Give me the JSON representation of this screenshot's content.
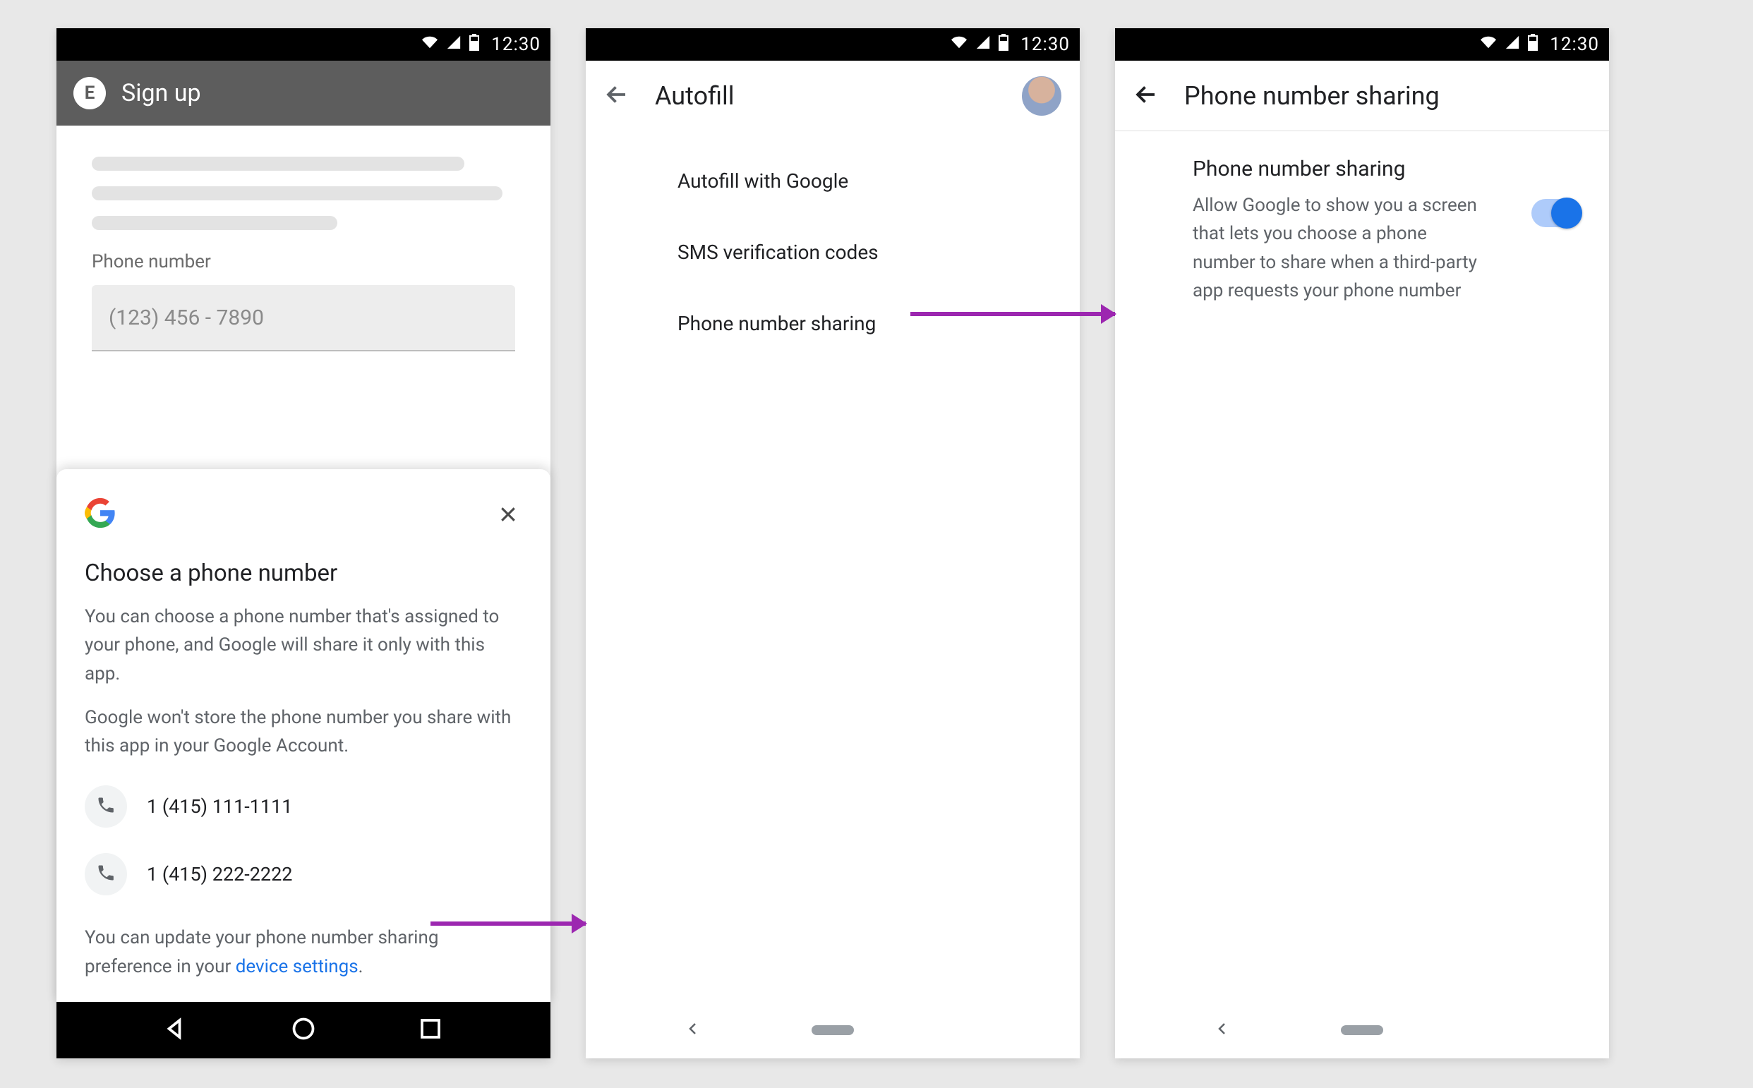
{
  "status": {
    "time": "12:30"
  },
  "screen1": {
    "app_badge": "E",
    "title": "Sign up",
    "field_label": "Phone number",
    "placeholder": "(123) 456 - 7890",
    "sheet": {
      "heading": "Choose a phone number",
      "para1": "You can choose a phone number that's assigned to your phone, and Google will share it only with this app.",
      "para2": "Google won't store the phone number you share with this app in your Google Account.",
      "numbers": [
        "1 (415) 111-1111",
        "1 (415) 222-2222"
      ],
      "footer_pre": "You can update your phone number sharing preference in your ",
      "footer_link": "device settings",
      "footer_post": "."
    }
  },
  "screen2": {
    "title": "Autofill",
    "items": [
      "Autofill with Google",
      "SMS verification codes",
      "Phone number sharing"
    ]
  },
  "screen3": {
    "title": "Phone number sharing",
    "setting_title": "Phone number sharing",
    "setting_desc": "Allow Google to show you a screen that lets you choose a phone number to share when a third-party app requests your phone number"
  }
}
